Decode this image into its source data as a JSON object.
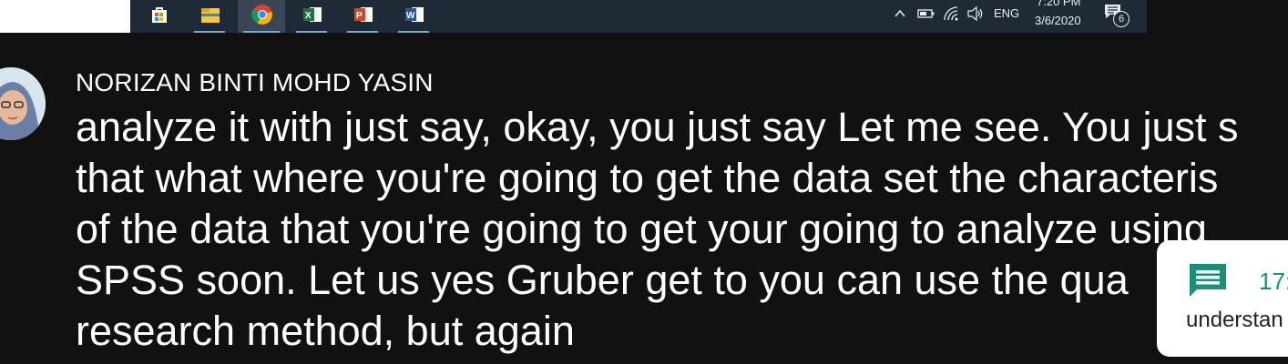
{
  "taskbar": {
    "apps": [
      {
        "name": "store-icon",
        "active": false
      },
      {
        "name": "file-explorer-icon",
        "active": false
      },
      {
        "name": "chrome-icon",
        "active": true
      },
      {
        "name": "excel-icon",
        "active": false
      },
      {
        "name": "powerpoint-icon",
        "active": false
      },
      {
        "name": "word-icon",
        "active": false
      }
    ],
    "language": "ENG",
    "time": "7:20 PM",
    "date": "3/6/2020",
    "notification_count": "6"
  },
  "chat": {
    "author": "NORIZAN BINTI MOHD YASIN",
    "message": "analyze it with just say, okay, you just say Let me see. You just s\nthat what where you're going to get the data set the characteris\nof the data that you're going to get your going to analyze using\nSPSS soon. Let us yes Gruber get to you can use the qua\nresearch method, but again"
  },
  "notification": {
    "time": "17:",
    "text": "understan"
  },
  "colors": {
    "background": "#111111",
    "taskbar": "#1f2a36",
    "accent_teal": "#1a8f7a"
  }
}
